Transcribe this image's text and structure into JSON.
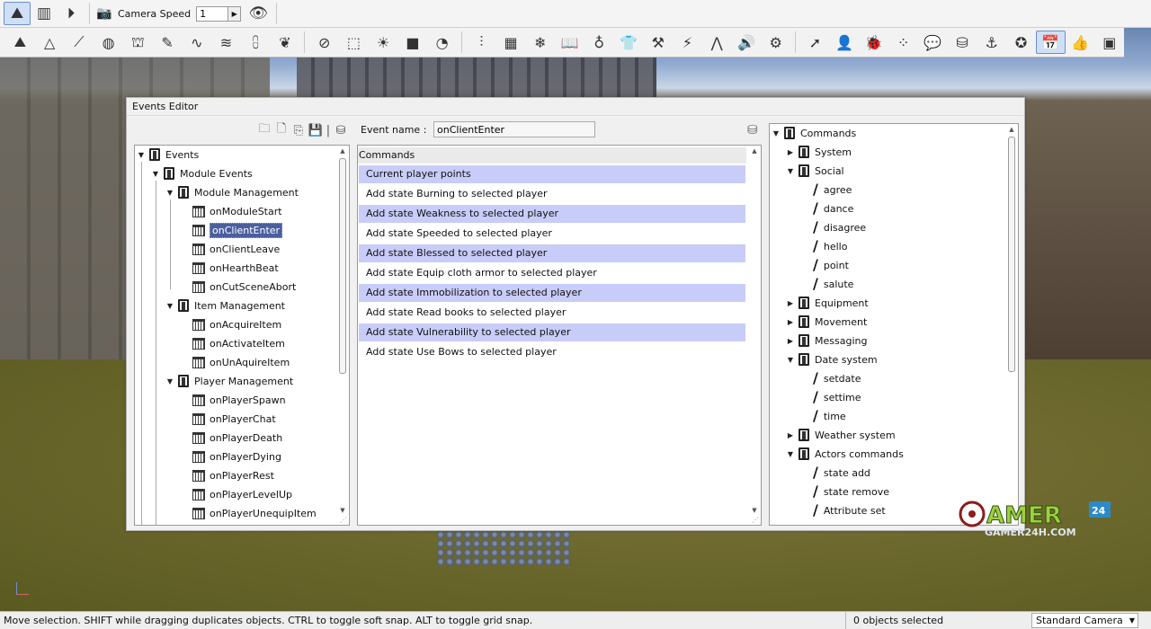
{
  "toolbar": {
    "camera_speed_label": "Camera Speed",
    "camera_speed_value": "1"
  },
  "icons_row1": [
    "terrain-icon",
    "layout-icon",
    "play-icon",
    "camera-icon",
    "eye-icon"
  ],
  "icons_row2": [
    "terrain-paint-icon",
    "mesh-icon",
    "brush-icon",
    "globe-icon",
    "stamp-icon",
    "sculpt-icon",
    "smooth-icon",
    "erode-icon",
    "flatten-icon",
    "leaf-icon",
    "compass-icon",
    "crop-icon",
    "sun-icon",
    "cube-icon",
    "sphere-icon",
    "sliders-icon",
    "table-icon",
    "snowflake-icon",
    "book-icon",
    "ring-icon",
    "shirt-icon",
    "hammer-icon",
    "wand-icon",
    "waveform-icon",
    "speaker-icon",
    "gears-icon",
    "arrow-icon",
    "person-icon",
    "bug-icon",
    "network-icon",
    "chat-icon",
    "database-icon",
    "anvil-icon",
    "badge-icon",
    "calendar-icon",
    "thumbs-up-icon",
    "data-icon"
  ],
  "window": {
    "title": "Events Editor",
    "event_name_label": "Event name :",
    "event_name_value": "onClientEnter"
  },
  "events_tree": {
    "root": "Events",
    "module_events": "Module Events",
    "groups": [
      {
        "label": "Module Management",
        "items": [
          "onModuleStart",
          "onClientEnter",
          "onClientLeave",
          "onHearthBeat",
          "onCutSceneAbort"
        ]
      },
      {
        "label": "Item Management",
        "items": [
          "onAcquireItem",
          "onActivateItem",
          "onUnAquireItem"
        ]
      },
      {
        "label": "Player Management",
        "items": [
          "onPlayerSpawn",
          "onPlayerChat",
          "onPlayerDeath",
          "onPlayerDying",
          "onPlayerRest",
          "onPlayerLevelUp",
          "onPlayerUnequipItem"
        ]
      }
    ],
    "selected": "onClientEnter"
  },
  "commands_list": {
    "header": "Commands",
    "rows": [
      "Current player points",
      "Add state Burning to selected player",
      "Add state Weakness to selected player",
      "Add state Speeded to selected player",
      "Add state Blessed to selected player",
      "Add state Equip cloth armor to selected player",
      "Add state Immobilization to selected player",
      "Add state Read books to selected player",
      "Add state Vulnerability to selected player",
      "Add state Use Bows to selected player"
    ]
  },
  "commands_tree": {
    "root": "Commands",
    "nodes": [
      {
        "label": "System",
        "level": 1,
        "type": "group",
        "open": false
      },
      {
        "label": "Social",
        "level": 1,
        "type": "group",
        "open": true
      },
      {
        "label": "agree",
        "level": 2,
        "type": "cmd"
      },
      {
        "label": "dance",
        "level": 2,
        "type": "cmd"
      },
      {
        "label": "disagree",
        "level": 2,
        "type": "cmd"
      },
      {
        "label": "hello",
        "level": 2,
        "type": "cmd"
      },
      {
        "label": "point",
        "level": 2,
        "type": "cmd"
      },
      {
        "label": "salute",
        "level": 2,
        "type": "cmd"
      },
      {
        "label": "Equipment",
        "level": 1,
        "type": "group",
        "open": false
      },
      {
        "label": "Movement",
        "level": 1,
        "type": "group",
        "open": false
      },
      {
        "label": "Messaging",
        "level": 1,
        "type": "group",
        "open": false
      },
      {
        "label": "Date system",
        "level": 1,
        "type": "group",
        "open": true
      },
      {
        "label": "setdate",
        "level": 2,
        "type": "cmd"
      },
      {
        "label": "settime",
        "level": 2,
        "type": "cmd"
      },
      {
        "label": "time",
        "level": 2,
        "type": "cmd"
      },
      {
        "label": "Weather system",
        "level": 1,
        "type": "group",
        "open": false
      },
      {
        "label": "Actors commands",
        "level": 1,
        "type": "group",
        "open": true
      },
      {
        "label": "state add",
        "level": 2,
        "type": "cmd"
      },
      {
        "label": "state remove",
        "level": 2,
        "type": "cmd"
      },
      {
        "label": "Attribute set",
        "level": 2,
        "type": "cmd"
      }
    ]
  },
  "status": {
    "message": "Move selection.  SHIFT while dragging duplicates objects.  CTRL to toggle soft snap.  ALT to toggle grid snap.",
    "selection_count": "0 objects selected",
    "camera_mode": "Standard Camera"
  },
  "watermark": {
    "text": "GAMER24H.COM"
  }
}
